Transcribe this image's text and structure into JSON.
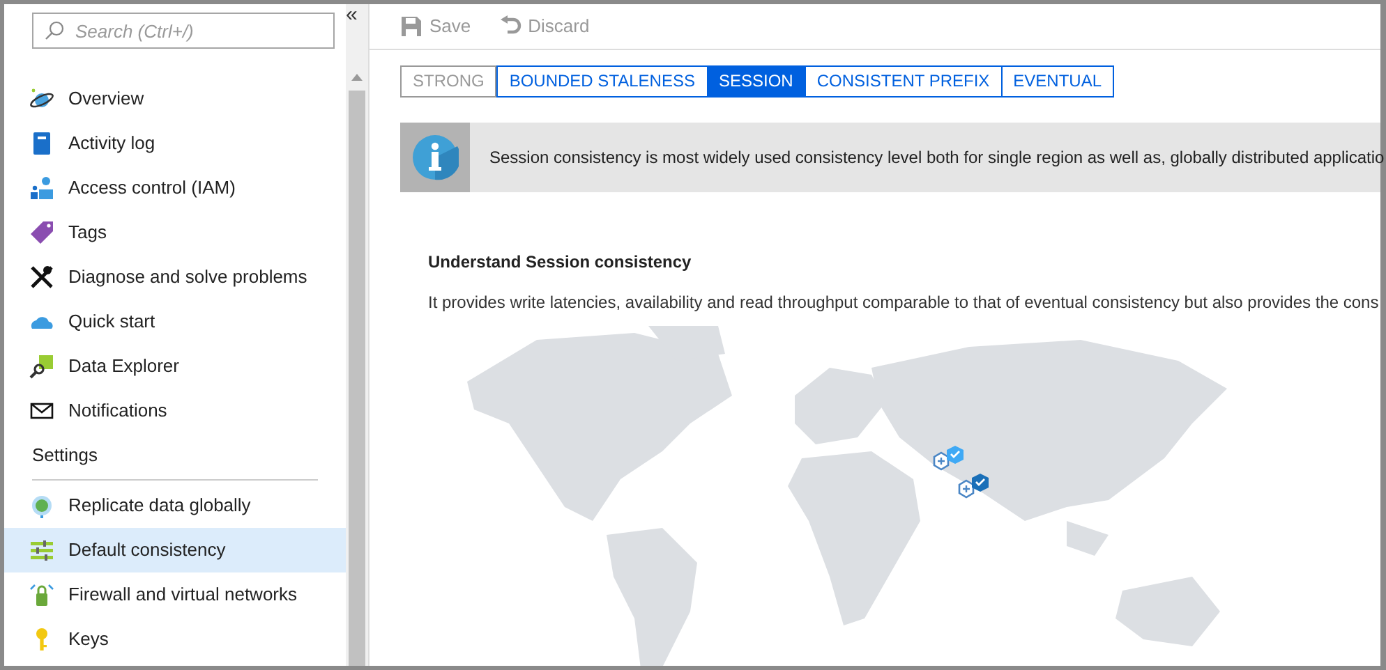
{
  "sidebar": {
    "search": {
      "placeholder": "Search (Ctrl+/)"
    },
    "collapse": "«",
    "items": [
      {
        "label": "Overview",
        "kind": "planet",
        "selected": false
      },
      {
        "label": "Activity log",
        "kind": "book",
        "selected": false
      },
      {
        "label": "Access control (IAM)",
        "kind": "people",
        "selected": false
      },
      {
        "label": "Tags",
        "kind": "tag",
        "selected": false
      },
      {
        "label": "Diagnose and solve problems",
        "kind": "tools",
        "selected": false
      },
      {
        "label": "Quick start",
        "kind": "cloud",
        "selected": false
      },
      {
        "label": "Data Explorer",
        "kind": "explorer",
        "selected": false
      },
      {
        "label": "Notifications",
        "kind": "envelope",
        "selected": false
      }
    ],
    "section": "Settings",
    "settings_items": [
      {
        "label": "Replicate data globally",
        "kind": "globe",
        "selected": false
      },
      {
        "label": "Default consistency",
        "kind": "sliders",
        "selected": true
      },
      {
        "label": "Firewall and virtual networks",
        "kind": "firewall",
        "selected": false
      },
      {
        "label": "Keys",
        "kind": "key",
        "selected": false
      }
    ]
  },
  "toolbar": [
    {
      "label": "Save",
      "kind": "save",
      "disabled": true
    },
    {
      "label": "Discard",
      "kind": "undo",
      "disabled": true
    }
  ],
  "tabs": [
    {
      "label": "STRONG",
      "selected": false,
      "disabled": true
    },
    {
      "label": "BOUNDED STALENESS",
      "selected": false,
      "disabled": false
    },
    {
      "label": "SESSION",
      "selected": true,
      "disabled": false
    },
    {
      "label": "CONSISTENT PREFIX",
      "selected": false,
      "disabled": false
    },
    {
      "label": "EVENTUAL",
      "selected": false,
      "disabled": false
    }
  ],
  "info": "Session consistency is most widely used consistency level both for single region as well as, globally distributed applicatio",
  "heading": "Understand Session consistency",
  "description": "It provides write latencies, availability and read throughput comparable to that of eventual consistency but also provides the cons"
}
